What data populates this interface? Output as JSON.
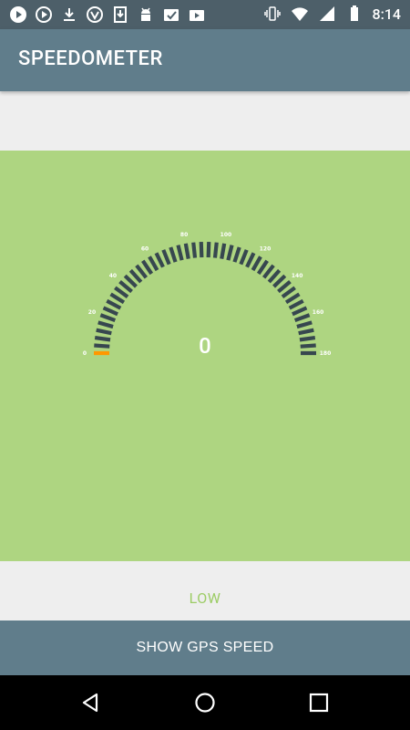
{
  "status_bar": {
    "left_icons": [
      "play-icon",
      "play-icon",
      "download-icon",
      "shield-icon",
      "download-box-icon",
      "android-icon",
      "checklist-icon",
      "media-icon"
    ],
    "right_icons": [
      "vibrate-icon",
      "wifi-icon",
      "signal-icon",
      "battery-icon"
    ],
    "time": "8:14"
  },
  "app_bar": {
    "title": "SPEEDOMETER"
  },
  "gauge": {
    "speed_value": "0",
    "tick_labels": [
      "0",
      "20",
      "40",
      "60",
      "80",
      "100",
      "120",
      "140",
      "160",
      "180"
    ],
    "min": 0,
    "max": 180,
    "current": 0,
    "tick_count": 46,
    "active_color": "#ff9800",
    "inactive_color": "#37474f"
  },
  "level_label": "LOW",
  "gps_button_label": "SHOW GPS SPEED",
  "nav_bar": [
    "back-icon",
    "home-icon",
    "recents-icon"
  ],
  "colors": {
    "app_bar": "#607d8b",
    "status_bar": "#4d5f69",
    "gauge_background": "#aed581",
    "level_text": "#9ccc65"
  }
}
